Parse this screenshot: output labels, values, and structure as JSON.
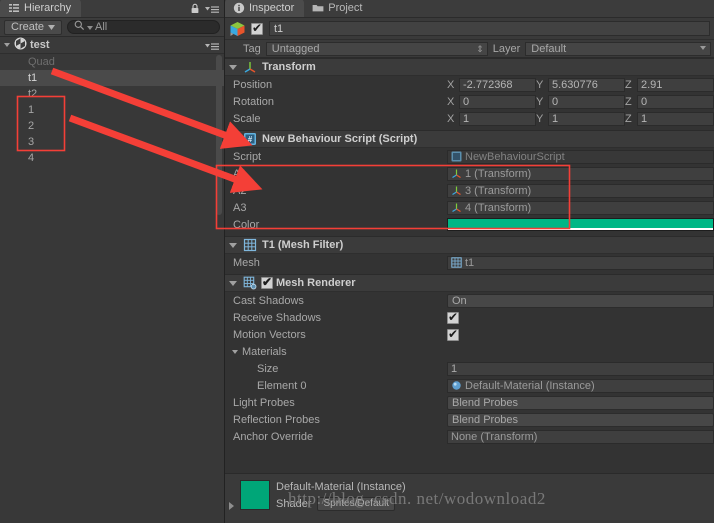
{
  "hierarchy": {
    "tab_label": "Hierarchy",
    "tab_icon": "hierarchy-icon",
    "create_label": "Create",
    "search_placeholder": "All",
    "search_value": "All",
    "scene_name": "test",
    "items": [
      {
        "label": "Quad",
        "selected": false,
        "dim": true
      },
      {
        "label": "t1",
        "selected": true,
        "dim": false
      },
      {
        "label": "t2",
        "selected": false,
        "dim": false
      },
      {
        "label": "1",
        "selected": false,
        "dim": false
      },
      {
        "label": "2",
        "selected": false,
        "dim": false
      },
      {
        "label": "3",
        "selected": false,
        "dim": false
      },
      {
        "label": "4",
        "selected": false,
        "dim": false
      }
    ]
  },
  "inspector": {
    "tab_label": "Inspector",
    "project_tab_label": "Project",
    "object": {
      "name": "t1",
      "enabled": true,
      "tag_label": "Tag",
      "tag_value": "Untagged",
      "layer_label": "Layer",
      "layer_value": "Default"
    },
    "transform": {
      "title": "Transform",
      "rows": [
        {
          "label": "Position",
          "x": "-2.772368",
          "y": "5.630776",
          "z": "2.91"
        },
        {
          "label": "Rotation",
          "x": "0",
          "y": "0",
          "z": "0"
        },
        {
          "label": "Scale",
          "x": "1",
          "y": "1",
          "z": "1"
        }
      ],
      "axis_x": "X",
      "axis_y": "Y",
      "axis_z": "Z"
    },
    "script_component": {
      "title": "New Behaviour Script (Script)",
      "script_label": "Script",
      "script_value": "NewBehaviourScript",
      "fields": [
        {
          "label": "A1",
          "value": "1 (Transform)"
        },
        {
          "label": "A2",
          "value": "3 (Transform)"
        },
        {
          "label": "A3",
          "value": "4 (Transform)"
        }
      ],
      "color_label": "Color",
      "color_value": "#00b786"
    },
    "mesh_filter": {
      "title": "T1 (Mesh Filter)",
      "mesh_label": "Mesh",
      "mesh_value": "t1"
    },
    "mesh_renderer": {
      "title": "Mesh Renderer",
      "enabled": true,
      "cast_shadows_label": "Cast Shadows",
      "cast_shadows_value": "On",
      "receive_shadows_label": "Receive Shadows",
      "receive_shadows_checked": true,
      "motion_vectors_label": "Motion Vectors",
      "motion_vectors_checked": true,
      "materials_label": "Materials",
      "size_label": "Size",
      "size_value": "1",
      "element0_label": "Element 0",
      "element0_value": "Default-Material (Instance)",
      "light_probes_label": "Light Probes",
      "light_probes_value": "Blend Probes",
      "reflection_probes_label": "Reflection Probes",
      "reflection_probes_value": "Blend Probes",
      "anchor_override_label": "Anchor Override",
      "anchor_override_value": "None (Transform)"
    },
    "material_preview": {
      "title": "Default-Material (Instance)",
      "shader_label": "Shader",
      "shader_value": "Sprites/Default",
      "swatch_color": "#00a678"
    }
  },
  "watermark": {
    "text": "http://blog. csdn. net/wodownload2"
  },
  "annotations": {
    "accent_color": "#f43f37"
  }
}
